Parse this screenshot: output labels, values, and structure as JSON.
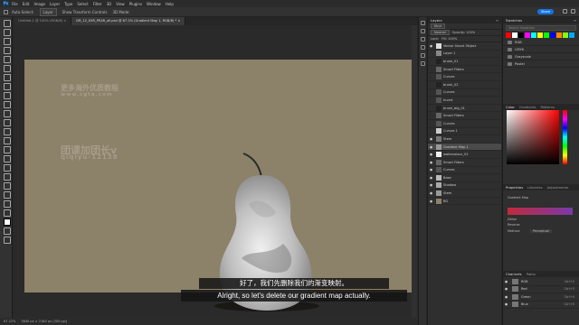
{
  "menu": [
    "File",
    "Edit",
    "Image",
    "Layer",
    "Type",
    "Select",
    "Filter",
    "3D",
    "View",
    "Plugins",
    "Window",
    "Help"
  ],
  "logo": "Ps",
  "options": {
    "auto_select": "Auto-Select:",
    "auto_select_value": "Layer",
    "show_transform": "Show Transform Controls",
    "mode_3d": "3D Mode:"
  },
  "share_label": "Share",
  "doc_tabs": [
    {
      "label": "Untitled-1 @ 100% (RGB/8) ×"
    },
    {
      "label": "DR_12_EXR_PEAR_all.psd @ 67.2% (Gradient Map 1, RGB/8) * ×"
    }
  ],
  "watermark": {
    "line1": "更多海外优质教程",
    "line2": "www.cgtq.com",
    "line3": "团课加团长v",
    "line4": "qiqiyu-12138"
  },
  "subtitle": {
    "cn": "好了，我们先删除我们的渐变映射。",
    "en": "Alright, so let's delete our gradient map actually."
  },
  "status": {
    "zoom": "67.22%",
    "dims": "3840 px × 2160 px (300 ppi)"
  },
  "layers_panel": {
    "title": "Layers",
    "kind_label": "Kind",
    "blend": "Normal",
    "opacity": "Opacity: 100%",
    "lock": "Lock:",
    "fill": "Fill: 100%",
    "rows": [
      {
        "name": "Vector Smart Object",
        "eye": "●",
        "sel": false,
        "thumb": "#ddd"
      },
      {
        "name": "Layer 1",
        "eye": "",
        "sel": false,
        "thumb": "#888"
      },
      {
        "name": "brush_01",
        "eye": "",
        "sel": false,
        "thumb": "#222"
      },
      {
        "name": "Smart Filters",
        "eye": "",
        "sel": false,
        "thumb": "#666"
      },
      {
        "name": "Curves",
        "eye": "",
        "sel": false,
        "thumb": "#555"
      },
      {
        "name": "brush_02",
        "eye": "",
        "sel": false,
        "thumb": "#222"
      },
      {
        "name": "Curves",
        "eye": "",
        "sel": false,
        "thumb": "#555"
      },
      {
        "name": "Invert",
        "eye": "",
        "sel": false,
        "thumb": "#555"
      },
      {
        "name": "brush_big_01",
        "eye": "",
        "sel": false,
        "thumb": "#222"
      },
      {
        "name": "Smart Filters",
        "eye": "",
        "sel": false,
        "thumb": "#666"
      },
      {
        "name": "Curves",
        "eye": "",
        "sel": false,
        "thumb": "#555"
      },
      {
        "name": "Curves 1",
        "eye": "",
        "sel": false,
        "thumb": "#ccc"
      },
      {
        "name": "Stem",
        "eye": "●",
        "sel": false,
        "thumb": "#777"
      },
      {
        "name": "Gradient Map 1",
        "eye": "●",
        "sel": true,
        "thumb": "#999"
      },
      {
        "name": "watercolour_01",
        "eye": "●",
        "sel": false,
        "thumb": "#eee"
      },
      {
        "name": "Smart Filters",
        "eye": "●",
        "sel": false,
        "thumb": "#666"
      },
      {
        "name": "Curves",
        "eye": "●",
        "sel": false,
        "thumb": "#555"
      },
      {
        "name": "Base",
        "eye": "●",
        "sel": false,
        "thumb": "#bbb"
      },
      {
        "name": "Shadow",
        "eye": "●",
        "sel": false,
        "thumb": "#aaa"
      },
      {
        "name": "Stem",
        "eye": "●",
        "sel": false,
        "thumb": "#999"
      },
      {
        "name": "BG",
        "eye": "●",
        "sel": false,
        "thumb": "#8c8169"
      }
    ]
  },
  "swatches": {
    "title": "Swatches",
    "search_placeholder": "Search Swatches",
    "colors": [
      "#ff0000",
      "#ffffff",
      "#000000",
      "#ff00ff",
      "#00ffff",
      "#ffff00",
      "#00ff00",
      "#0000ff",
      "#ff8800",
      "#88ff00",
      "#00aaff"
    ],
    "folders": [
      "RGB",
      "CMYK",
      "Grayscale",
      "Pastel"
    ]
  },
  "color_panel": {
    "title": "Color",
    "tab2": "Gradients",
    "tab3": "Patterns"
  },
  "properties": {
    "title": "Properties",
    "tab2": "Libraries",
    "tab3": "Adjustments",
    "type": "Gradient Map",
    "dither": "Dither",
    "reverse": "Reverse",
    "method_label": "Method:",
    "method_value": "Perceptual"
  },
  "channels": {
    "title": "Channels",
    "tab2": "Paths",
    "rows": [
      {
        "name": "RGB",
        "key": "Ctrl+2"
      },
      {
        "name": "Red",
        "key": "Ctrl+3"
      },
      {
        "name": "Green",
        "key": "Ctrl+4"
      },
      {
        "name": "Blue",
        "key": "Ctrl+5"
      }
    ]
  }
}
